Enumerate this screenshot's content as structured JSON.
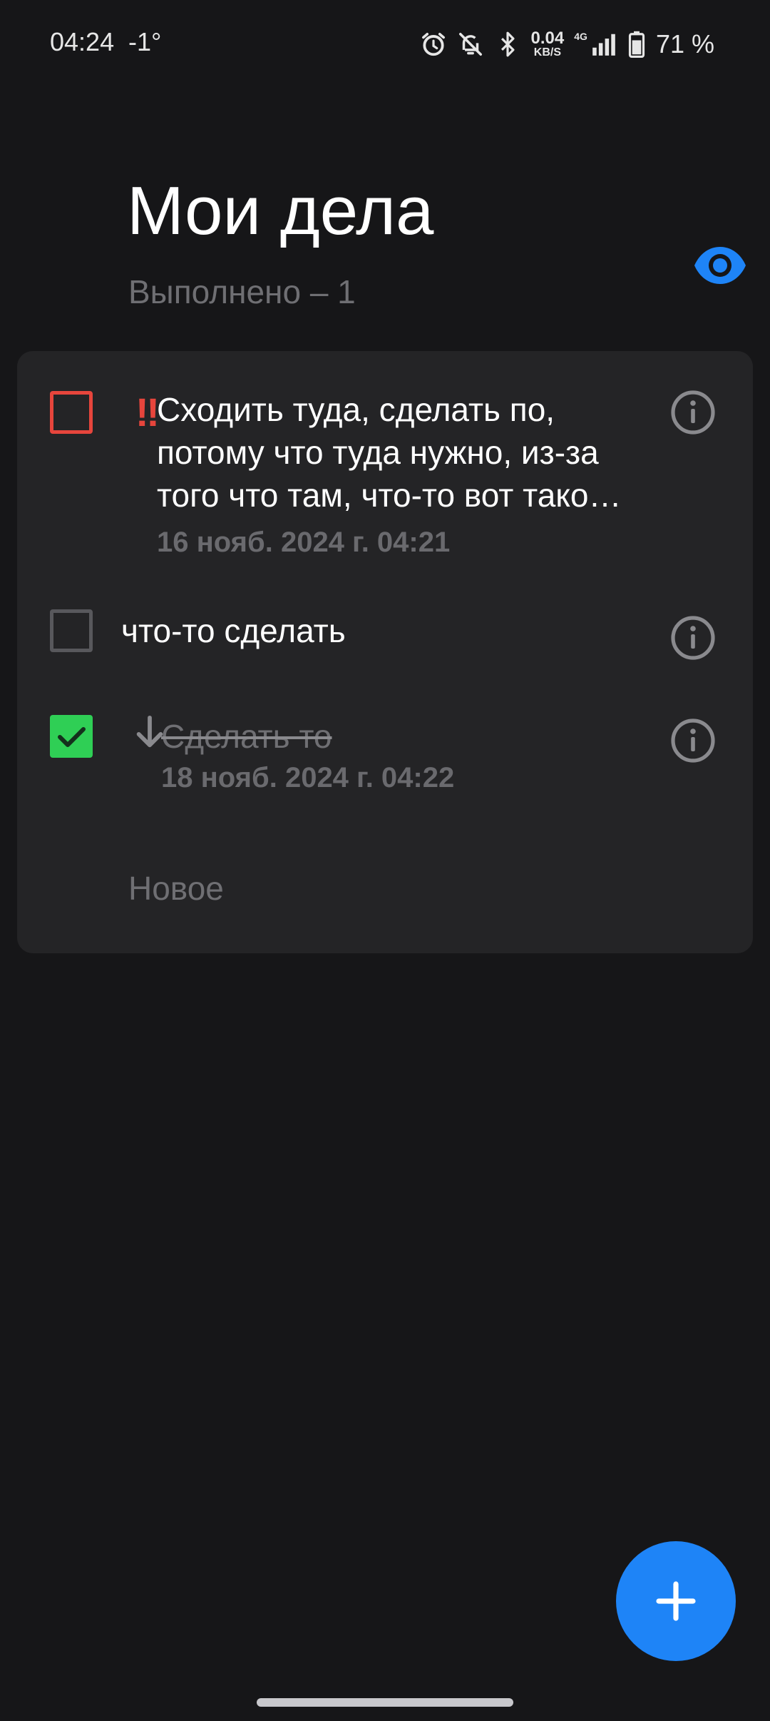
{
  "status_bar": {
    "time": "04:24",
    "temperature": "-1°",
    "net_speed_value": "0.04",
    "net_speed_unit": "KB/S",
    "network_type": "4G",
    "battery_percent": "71 %",
    "icons": [
      "alarm-icon",
      "notifications-off-icon",
      "bluetooth-icon",
      "signal-icon",
      "battery-icon"
    ]
  },
  "header": {
    "title": "Мои дела",
    "subtitle": "Выполнено – 1",
    "visibility_icon": "eye-icon",
    "accent_color": "#1e84f7"
  },
  "tasks": [
    {
      "text": "Сходить туда, сделать по, потому что туда нужно, из-за того что там, что-то вот тако…",
      "date": "16 нояб. 2024 г. 04:21",
      "priority": "high",
      "priority_mark": "‼",
      "done": false
    },
    {
      "text": "что-то сделать",
      "date": "",
      "priority": "none",
      "done": false
    },
    {
      "text": "Сделать то",
      "date": "18 нояб. 2024 г. 04:22",
      "priority": "low",
      "done": true
    }
  ],
  "new_task": {
    "placeholder": "Новое"
  },
  "fab": {
    "icon": "plus-icon"
  },
  "colors": {
    "background": "#161618",
    "card": "#242426",
    "high_priority": "#e6453c",
    "done_check": "#2fcf55",
    "accent": "#1e84f7",
    "secondary_text": "#6f6f73"
  }
}
